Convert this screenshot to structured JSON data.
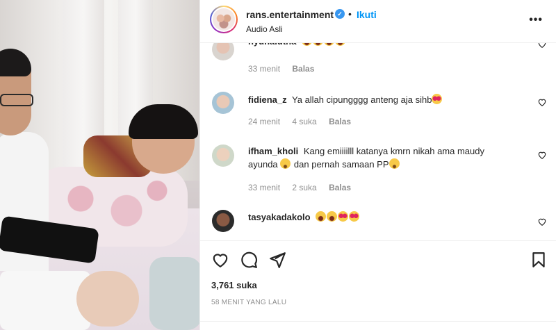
{
  "header": {
    "username": "rans.entertainment",
    "follow_label": "Ikuti",
    "subtitle": "Audio Asli",
    "more_label": "•••"
  },
  "comments": [
    {
      "user": "nyunaiutha",
      "text": "",
      "emojis": [
        "laugh",
        "laugh",
        "laugh",
        "laugh"
      ],
      "time": "33 menit",
      "likes": "",
      "reply": "Balas"
    },
    {
      "user": "fidiena_z",
      "text": "Ya allah cipungggg anteng aja sihb",
      "emojis": [
        "heart"
      ],
      "time": "24 menit",
      "likes": "4 suka",
      "reply": "Balas"
    },
    {
      "user": "ifham_kholi",
      "text": "Kang emiiiilll katanya kmrn nikah ama maudy ayunda",
      "text2": "dan pernah samaan PP",
      "emojis": [
        "sad"
      ],
      "time": "33 menit",
      "likes": "2 suka",
      "reply": "Balas"
    },
    {
      "user": "tasyakadakolo",
      "text": "",
      "emojis": [
        "laugh",
        "laugh",
        "heart",
        "heart"
      ],
      "time": "",
      "likes": "",
      "reply": ""
    }
  ],
  "actions": {
    "likes": "3,761 suka",
    "time_ago": "58 MENIT YANG LALU"
  },
  "colors": {
    "accent": "#0095f6",
    "verified": "#3897f0",
    "muted": "#8e8e8e"
  },
  "icons": [
    "heart-icon",
    "comment-icon",
    "share-icon",
    "bookmark-icon",
    "verified-icon",
    "more-icon"
  ]
}
